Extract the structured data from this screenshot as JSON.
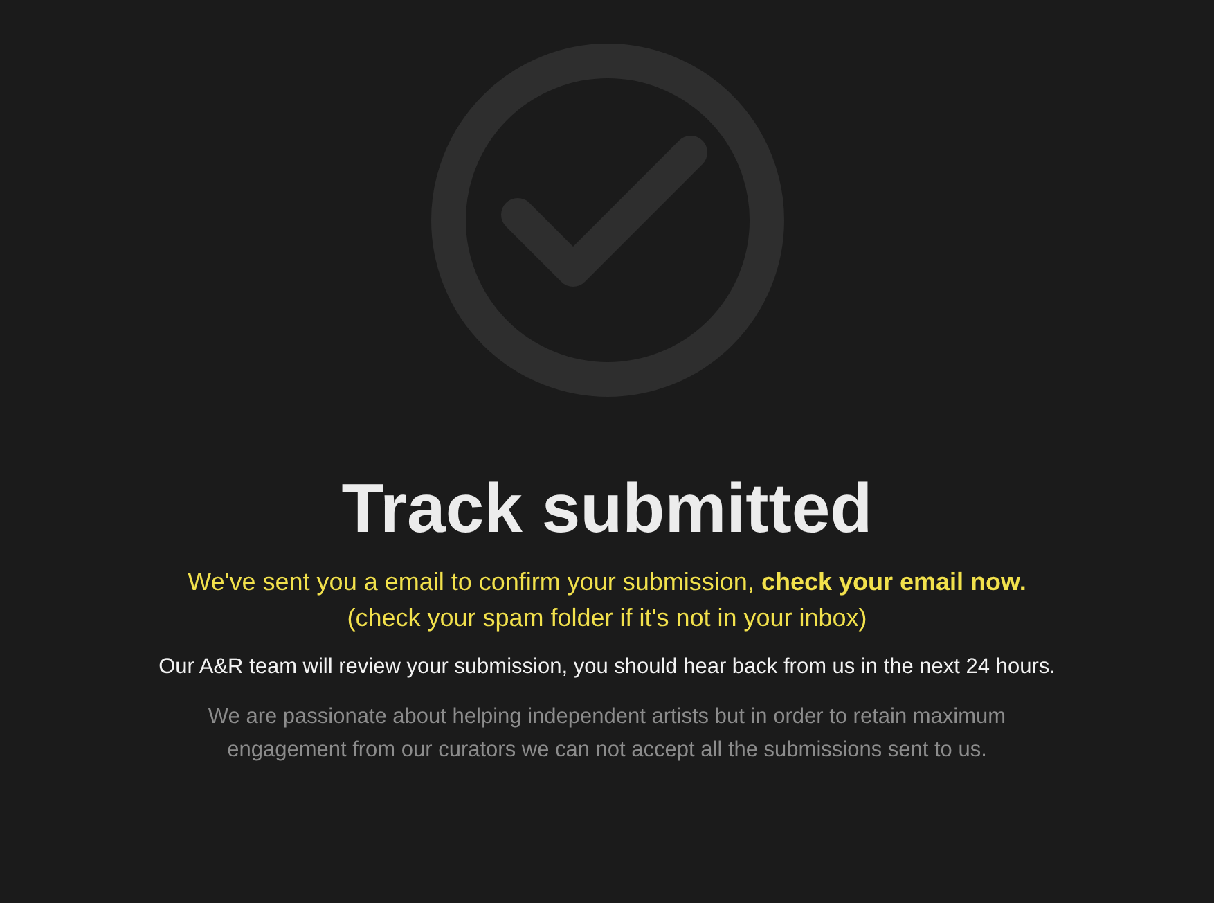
{
  "title": "Track submitted",
  "confirmation": "We've sent you a email to confirm your submission, **check your email now.**",
  "spam_note": "(check your spam folder if it's not in your inbox)",
  "review_note": "Our A&R team will review your submission, you should hear back from us in the next 24 hours.",
  "disclaimer": "We are passionate about helping independent artists but in order to retain maximum engagement from our curators we can not accept all the submissions sent to us."
}
